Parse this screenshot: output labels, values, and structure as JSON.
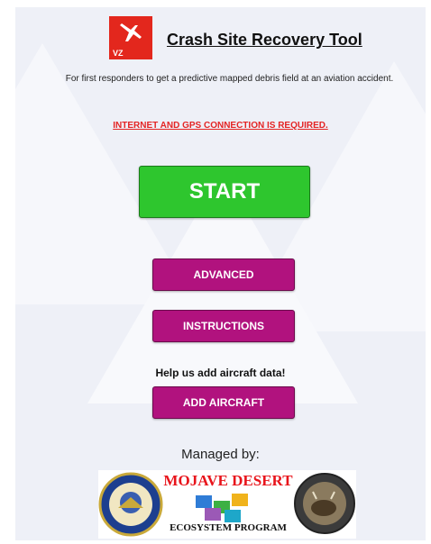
{
  "header": {
    "app_icon_label": "VZ",
    "title": "Crash Site Recovery Tool"
  },
  "description": "For first responders to get a predictive mapped debris field at an aviation accident.",
  "warning": "INTERNET AND GPS CONNECTION IS REQUIRED.",
  "buttons": {
    "start": "START",
    "advanced": "ADVANCED",
    "instructions": "INSTRUCTIONS",
    "add_aircraft": "ADD AIRCRAFT"
  },
  "help_text": "Help us add aircraft data!",
  "managed_by": "Managed by:",
  "sponsor_logo": {
    "line1": "MOJAVE DESERT",
    "line2": "ECOSYSTEM PROGRAM"
  },
  "colors": {
    "start_button": "#2ec62e",
    "purple_button": "#b1127e",
    "warning": "#e42424",
    "app_icon": "#e3271d"
  }
}
